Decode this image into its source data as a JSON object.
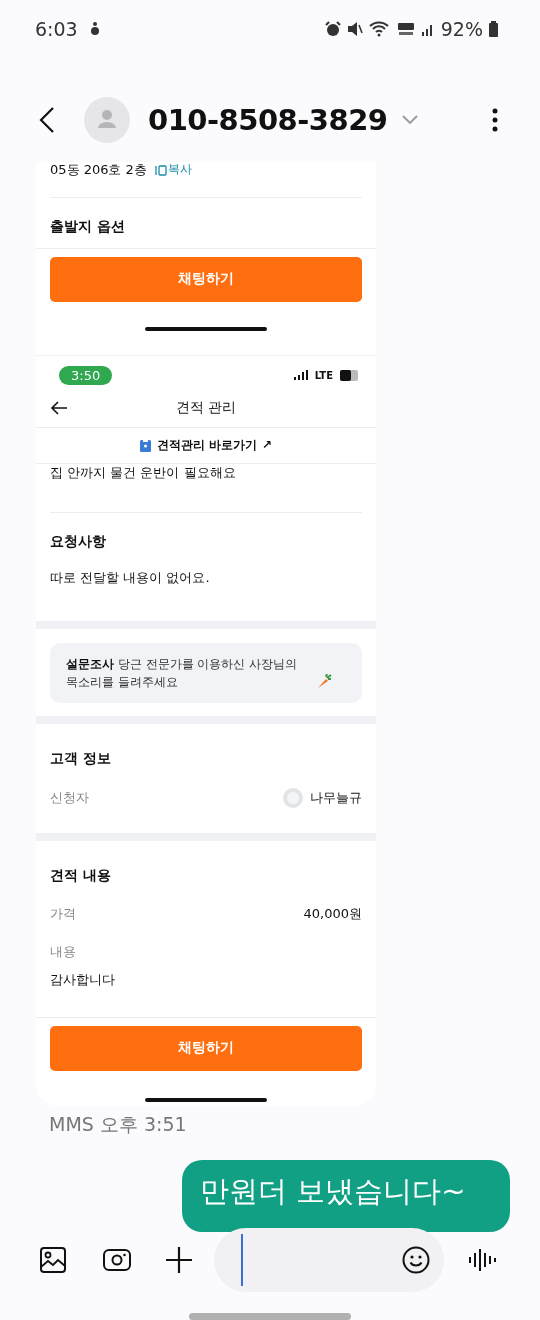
{
  "status_bar": {
    "time": "6:03",
    "battery": "92%"
  },
  "header": {
    "title": "010-8508-3829"
  },
  "attachment": {
    "top": {
      "address": "05동 206호 2층",
      "copy_label": "복사",
      "section_title": "출발지 옵션",
      "button": "채팅하기"
    },
    "bottom": {
      "status_time": "3:50",
      "network": "LTE",
      "nav_title": "견적 관리",
      "link": "견적관리 바로가기 ↗",
      "note": "집 안까지 물건 운반이 필요해요",
      "request": {
        "title": "요청사항",
        "text": "따로 전달할 내용이 없어요."
      },
      "survey": {
        "text": "**설문조사** 당근 전문가를 이용하신 사장님의 목소리를 들려주세요"
      },
      "customer": {
        "title": "고객 정보",
        "label": "신청자",
        "name": "나무늘규"
      },
      "quote": {
        "title": "견적 내용",
        "price_label": "가격",
        "price": "40,000원",
        "content_label": "내용",
        "content": "감사합니다"
      },
      "button": "채팅하기"
    }
  },
  "meta": "MMS 오후 3:51",
  "message": {
    "text": "만원더 보냈습니다~"
  }
}
